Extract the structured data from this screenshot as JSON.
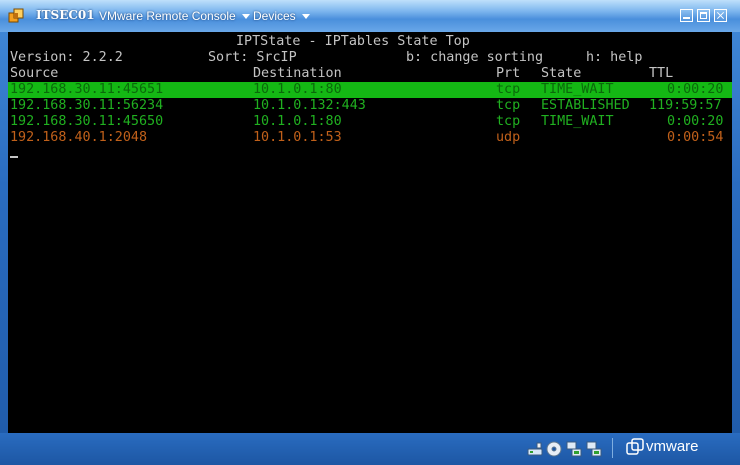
{
  "window": {
    "title": "ITSEC01",
    "menus": [
      {
        "label": "VMware Remote Console"
      },
      {
        "label": "Devices"
      }
    ]
  },
  "console": {
    "title": "IPTState - IPTables State Top",
    "version": "Version: 2.2.2",
    "sort": "Sort: SrcIP",
    "help_b": "b: change sorting",
    "help_h": "h: help",
    "headers": {
      "source": "Source",
      "destination": "Destination",
      "protocol": "Prt",
      "state": "State",
      "ttl": "TTL"
    },
    "rows": [
      {
        "source": "192.168.30.11:45651",
        "destination": "10.1.0.1:80",
        "protocol": "tcp",
        "state": "TIME_WAIT",
        "ttl": "0:00:20",
        "color": "highlight"
      },
      {
        "source": "192.168.30.11:56234",
        "destination": "10.1.0.132:443",
        "protocol": "tcp",
        "state": "ESTABLISHED",
        "ttl": "119:59:57",
        "color": "green"
      },
      {
        "source": "192.168.30.11:45650",
        "destination": "10.1.0.1:80",
        "protocol": "tcp",
        "state": "TIME_WAIT",
        "ttl": "0:00:20",
        "color": "green"
      },
      {
        "source": "192.168.40.1:2048",
        "destination": "10.1.0.1:53",
        "protocol": "udp",
        "state": "",
        "ttl": "0:00:54",
        "color": "orange"
      }
    ]
  },
  "statusbar": {
    "icons": [
      "network-icon",
      "cdrom-icon",
      "network-adapter-icon",
      "network-adapter-2-icon"
    ],
    "brand": "vmware"
  },
  "colors": {
    "highlight_row": "#14b814",
    "green_text": "#20b020",
    "orange_text": "#c0601a",
    "white_text": "#c4c4c4"
  }
}
